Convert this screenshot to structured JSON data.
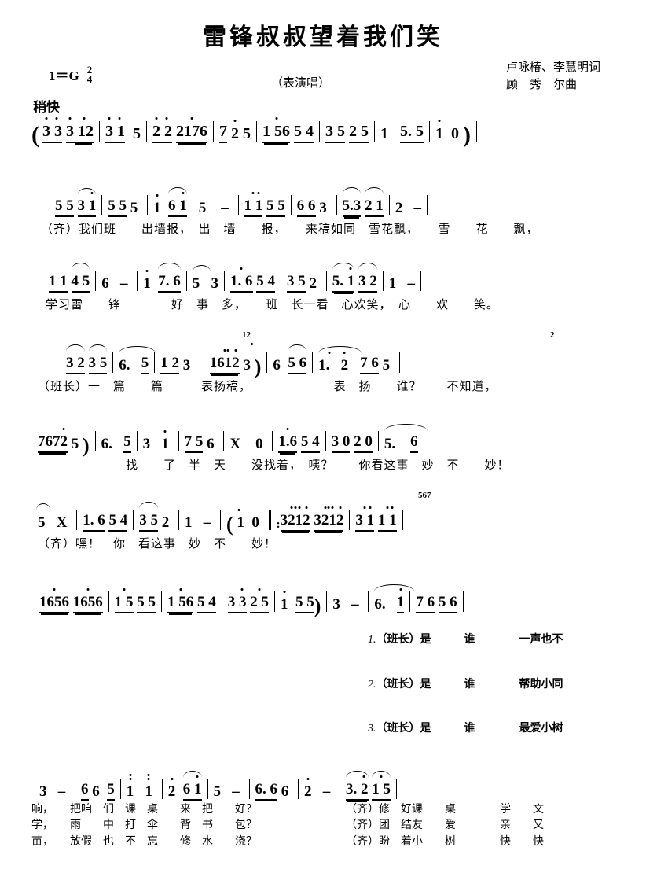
{
  "header": {
    "title": "雷锋叔叔望着我们笑",
    "key_signature": "1＝G",
    "time_signature_num": "2",
    "time_signature_den": "4",
    "performance_type": "（表演唱）",
    "lyricists": "卢咏椿、李慧明词",
    "composer": "顾　秀　尔曲",
    "tempo": "稍快"
  },
  "systems": [
    {
      "id": "prelude",
      "notes_text": "（3 3 3 12 │ 3 1 5 ǀ 2 2 2176 │ 7 2 5 ǀ 1 56 5 4 │ 3 5 2 5 ǀ 1 5. 5 │ 1 0 ）ǀ",
      "lyrics": ""
    },
    {
      "id": "line-2",
      "notes_text": "5 5 3 1 │ 5 5 5 ǀ 1 6 1 │ 5 - ǀ 1 1 5 5 │ 6 6 3 ǀ 5.3 2 1 │ 2 - ǀ",
      "lyrics": "（齐）我们班　　出墙报，　出　墙　　报，　　来稿如同　雪花飘，　　雪　　花　　飘，"
    },
    {
      "id": "line-3",
      "notes_text": "1 1 4 5 │ 6 - ǀ 1 7. 6 │ 5 3 ǀ 1. 6 5 4 │ 3 5 2 ǀ 5. 1 3 2 │ 1 - ǀ",
      "lyrics": "学习雷　　锋　　　　好　事　多，　　班　长一看　心欢笑，　心　　欢　　笑。"
    },
    {
      "id": "line-4",
      "notes_text": "3 2 3 5 │ 6. 5 ǀ 1 2 3 │ 1612 3 ） ǀ 6 56 │ 1. 2 ǀ 7 6 5",
      "lyrics": "（班长）一　篇　　篇　　　表扬稿，　　　　　　　表　扬　　谁？　　不知道，",
      "grace_notes": [
        "12",
        "2"
      ]
    },
    {
      "id": "line-5",
      "notes_text": "7672 5 ）ǀ 6. 5 │ 3 1 ǀ 7 5 6 │ X 0 ǀ 1.6 5 4 │ 3 0 2 0 ǀ 5. 6 │",
      "lyrics": "　　　　　　　找　　了　半　天　　没找着，　咦？　　你看这事　妙　不　　妙！"
    },
    {
      "id": "line-6",
      "notes_text": "5 X ǀ 1. 6 5 4 │ 3 5 2 ǀ 1 - │ （ 1 0 ‖: 3212 3212 │ 3 1 1 1 ǀ",
      "lyrics": "（齐）嘿！　你　看这事　妙　不　　妙！",
      "grace_notes": [
        "567"
      ]
    },
    {
      "id": "line-7",
      "notes_text": "1656 1656 │ 1 5 5 5 ǀ 1 56 5 4 │ 3 3 2 5 ǀ 1 5 5 ）ǀ 3 - │ 6. 1 ǀ 7 6 5 6 │",
      "lyrics": ""
    },
    {
      "id": "line-8",
      "notes_text": "3 - ǀ 6 6 5 │ 1 1 ǀ 2 6 1 │ 5 - ǀ 6. 6 6 │ 2 - ǀ 3. 2 1 5 │",
      "lyrics": ""
    }
  ],
  "verse_endings": [
    {
      "num": "1.",
      "role": "（班长）",
      "text": "是　　　谁　　　　一声也不"
    },
    {
      "num": "2.",
      "role": "（班长）",
      "text": "是　　　谁　　　　帮助小同"
    },
    {
      "num": "3.",
      "role": "（班长）",
      "text": "是　　　谁　　　　最爱小树"
    }
  ],
  "final_verses": [
    {
      "left": "响，　　把咱　们　课　桌　　来　把　　好？",
      "right": "（齐）修　好课　　桌　　　　学　　文"
    },
    {
      "left": "学，　　雨　　中　打　伞　　背　书　　包？",
      "right": "（齐）团　结友　　爱　　　　亲　　又"
    },
    {
      "left": "苗，　　放假　也　不　忘　　修　水　　浇？",
      "right": "（齐）盼　着小　　树　　　　快　　快"
    }
  ]
}
